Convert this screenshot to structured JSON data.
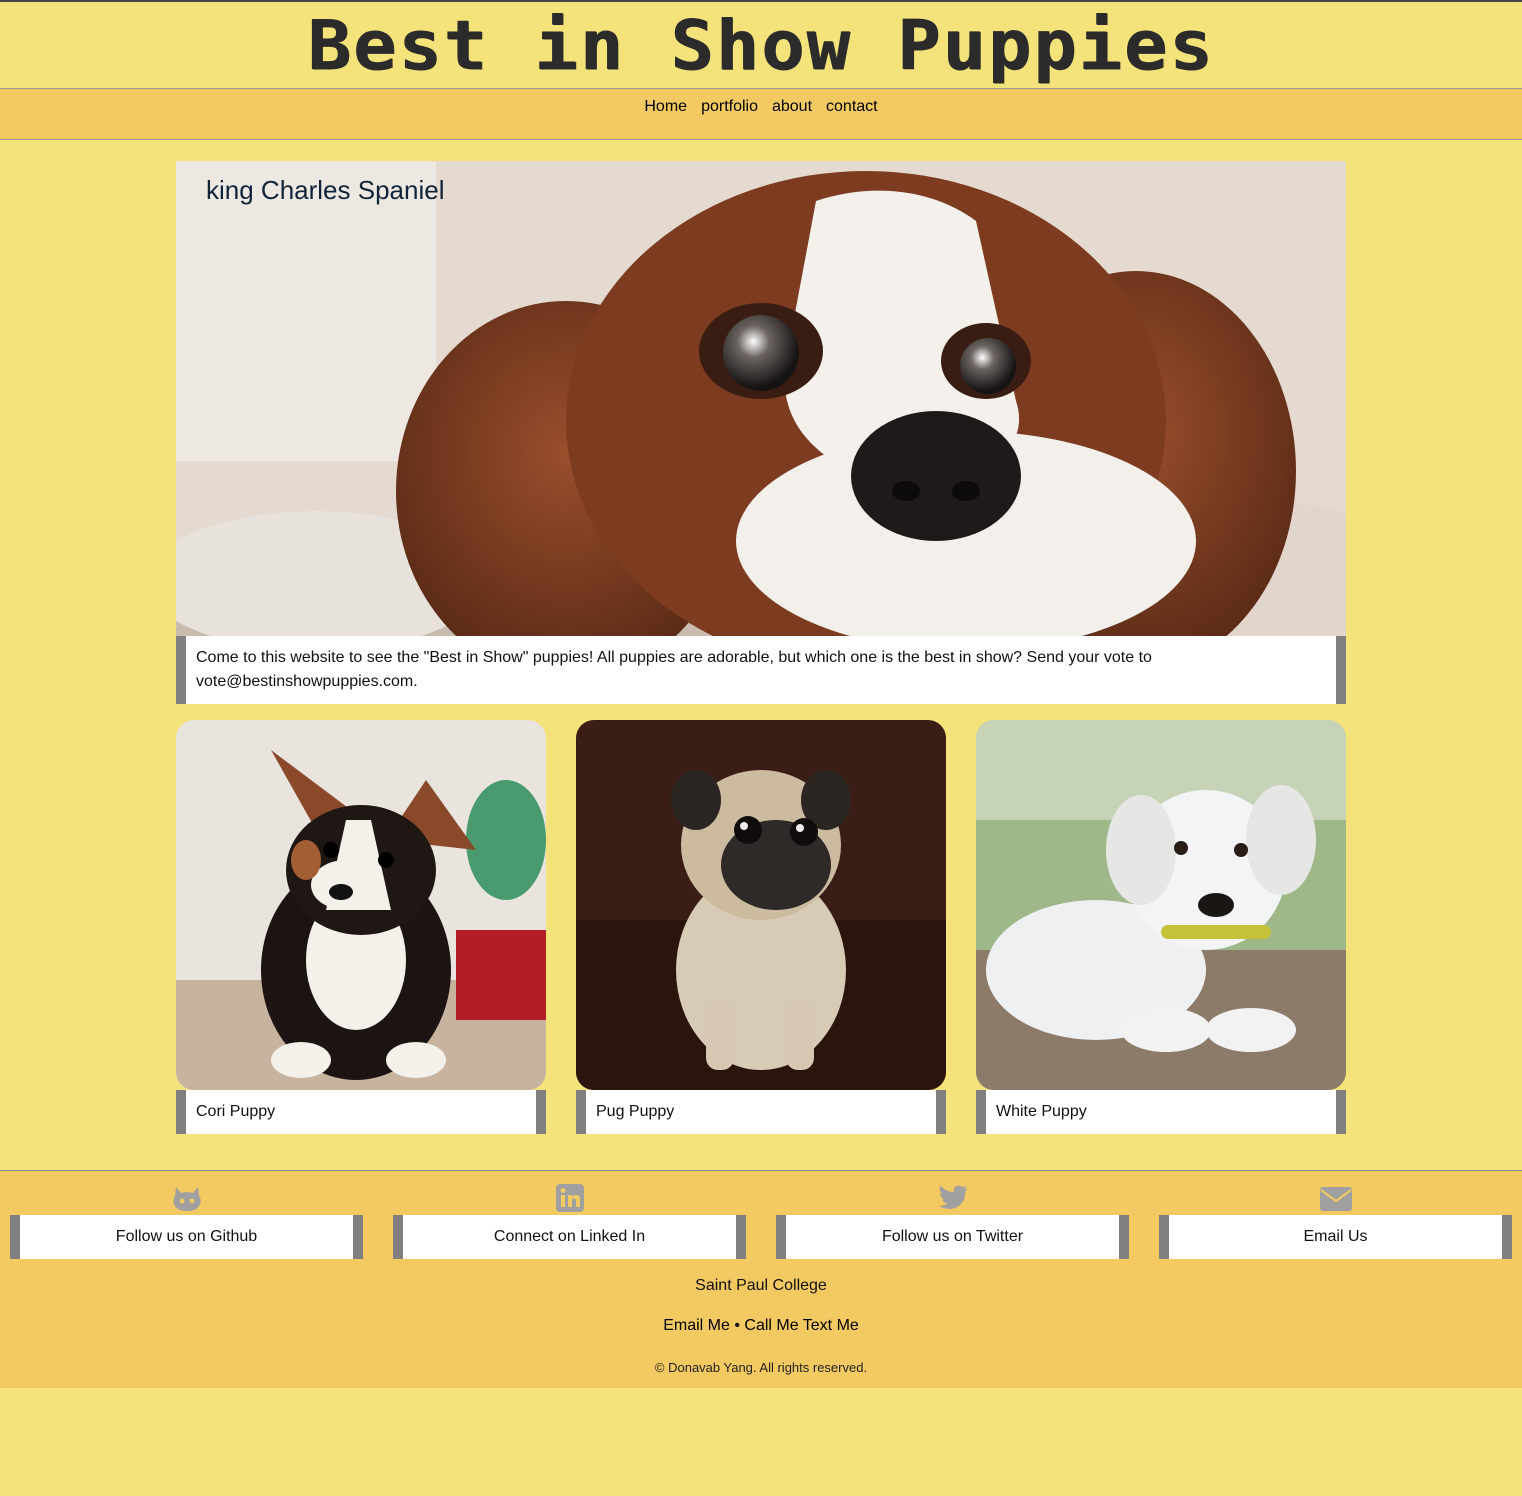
{
  "header": {
    "title": "Best in Show Puppies"
  },
  "nav": {
    "items": [
      "Home",
      "portfolio",
      "about",
      "contact"
    ]
  },
  "hero": {
    "title": "king Charles Spaniel",
    "caption": "Come to this website to see the \"Best in Show\" puppies! All puppies are adorable, but which one is the best in show? Send your vote to vote@bestinshowpuppies.com."
  },
  "cards": [
    {
      "caption": "Cori Puppy"
    },
    {
      "caption": "Pug Puppy"
    },
    {
      "caption": "White Puppy"
    }
  ],
  "footer": {
    "social": [
      {
        "label": "Follow us on Github",
        "icon": "github-icon"
      },
      {
        "label": "Connect on Linked In",
        "icon": "linkedin-icon"
      },
      {
        "label": "Follow us on Twitter",
        "icon": "twitter-icon"
      },
      {
        "label": "Email Us",
        "icon": "envelope-icon"
      }
    ],
    "college": "Saint Paul College",
    "email_me": "Email Me",
    "separator": "•",
    "call_me": "Call Me",
    "text_me": "Text Me",
    "copyright": "© Donavab Yang. All rights reserved."
  },
  "colors": {
    "page_background": "#f4e27a",
    "bar_background": "#f3c962",
    "caption_border": "#808080",
    "icon_gray": "#a0a0a0"
  }
}
